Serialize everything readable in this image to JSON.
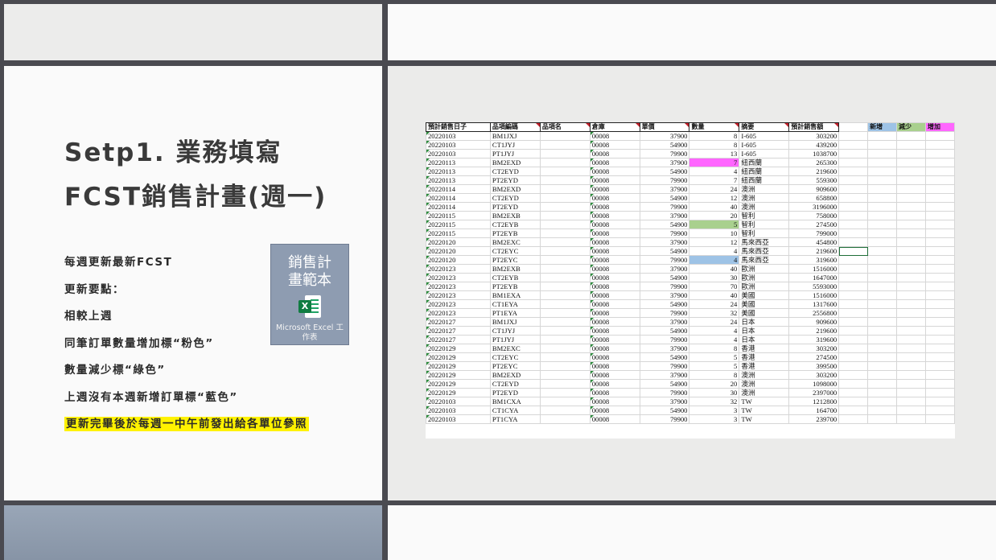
{
  "slide": {
    "title_line1": "Setp1. 業務填寫",
    "title_line2": "FCST銷售計畫(週一)",
    "notes": [
      "每週更新最新FCST",
      "更新要點：",
      "相較上週",
      "同筆訂單數量增加標“粉色”",
      "數量減少標“綠色”",
      "上週沒有本週新增訂單標“藍色”"
    ],
    "highlight_note": "更新完畢後於每週一中午前發出給各單位參照",
    "file_icon": {
      "name_line1": "銷售計",
      "name_line2": "畫範本",
      "caption_line1": "Microsoft Excel 工",
      "caption_line2": "作表",
      "icon": "excel-file-icon"
    }
  },
  "spreadsheet": {
    "headers": [
      "預計銷售日子",
      "品項編碼",
      "品項名",
      "倉庫",
      "單價",
      "數量",
      "摘要",
      "預計銷售額"
    ],
    "legend": [
      {
        "label": "新增",
        "color": "#9ec3e6"
      },
      {
        "label": "減少",
        "color": "#a9d08e"
      },
      {
        "label": "增加",
        "color": "#ff66ff"
      }
    ],
    "highlight_colors": {
      "pink": "#ff66ff",
      "green": "#a9d08e",
      "blue": "#9ec3e6"
    },
    "rows": [
      {
        "date": "20220103",
        "code": "BM1JXJ",
        "wh": "00008",
        "price": "37900",
        "qty": "8",
        "memo": "I-605",
        "amt": "303200"
      },
      {
        "date": "20220103",
        "code": "CT1JYJ",
        "wh": "00008",
        "price": "54900",
        "qty": "8",
        "memo": "I-605",
        "amt": "439200"
      },
      {
        "date": "20220103",
        "code": "PT1JYJ",
        "wh": "00008",
        "price": "79900",
        "qty": "13",
        "memo": "I-605",
        "amt": "1038700"
      },
      {
        "date": "20220113",
        "code": "BM2EXD",
        "wh": "00008",
        "price": "37900",
        "qty": "7",
        "memo": "紐西蘭",
        "amt": "265300",
        "hl": "pink"
      },
      {
        "date": "20220113",
        "code": "CT2EYD",
        "wh": "00008",
        "price": "54900",
        "qty": "4",
        "memo": "紐西蘭",
        "amt": "219600"
      },
      {
        "date": "20220113",
        "code": "PT2EYD",
        "wh": "00008",
        "price": "79900",
        "qty": "7",
        "memo": "紐西蘭",
        "amt": "559300"
      },
      {
        "date": "20220114",
        "code": "BM2EXD",
        "wh": "00008",
        "price": "37900",
        "qty": "24",
        "memo": "澳洲",
        "amt": "909600"
      },
      {
        "date": "20220114",
        "code": "CT2EYD",
        "wh": "00008",
        "price": "54900",
        "qty": "12",
        "memo": "澳洲",
        "amt": "658800"
      },
      {
        "date": "20220114",
        "code": "PT2EYD",
        "wh": "00008",
        "price": "79900",
        "qty": "40",
        "memo": "澳洲",
        "amt": "3196000"
      },
      {
        "date": "20220115",
        "code": "BM2EXB",
        "wh": "00008",
        "price": "37900",
        "qty": "20",
        "memo": "智利",
        "amt": "758000"
      },
      {
        "date": "20220115",
        "code": "CT2EYB",
        "wh": "00008",
        "price": "54900",
        "qty": "5",
        "memo": "智利",
        "amt": "274500",
        "hl": "green"
      },
      {
        "date": "20220115",
        "code": "PT2EYB",
        "wh": "00008",
        "price": "79900",
        "qty": "10",
        "memo": "智利",
        "amt": "799000"
      },
      {
        "date": "20220120",
        "code": "BM2EXC",
        "wh": "00008",
        "price": "37900",
        "qty": "12",
        "memo": "馬來西亞",
        "amt": "454800"
      },
      {
        "date": "20220120",
        "code": "CT2EYC",
        "wh": "00008",
        "price": "54900",
        "qty": "4",
        "memo": "馬來西亞",
        "amt": "219600"
      },
      {
        "date": "20220120",
        "code": "PT2EYC",
        "wh": "00008",
        "price": "79900",
        "qty": "4",
        "memo": "馬來西亞",
        "amt": "319600",
        "hl": "blue"
      },
      {
        "date": "20220123",
        "code": "BM2EXB",
        "wh": "00008",
        "price": "37900",
        "qty": "40",
        "memo": "歐洲",
        "amt": "1516000"
      },
      {
        "date": "20220123",
        "code": "CT2EYB",
        "wh": "00008",
        "price": "54900",
        "qty": "30",
        "memo": "歐洲",
        "amt": "1647000"
      },
      {
        "date": "20220123",
        "code": "PT2EYB",
        "wh": "00008",
        "price": "79900",
        "qty": "70",
        "memo": "歐洲",
        "amt": "5593000"
      },
      {
        "date": "20220123",
        "code": "BM1EXA",
        "wh": "00008",
        "price": "37900",
        "qty": "40",
        "memo": "美國",
        "amt": "1516000"
      },
      {
        "date": "20220123",
        "code": "CT1EYA",
        "wh": "00008",
        "price": "54900",
        "qty": "24",
        "memo": "美國",
        "amt": "1317600"
      },
      {
        "date": "20220123",
        "code": "PT1EYA",
        "wh": "00008",
        "price": "79900",
        "qty": "32",
        "memo": "美國",
        "amt": "2556800"
      },
      {
        "date": "20220127",
        "code": "BM1JXJ",
        "wh": "00008",
        "price": "37900",
        "qty": "24",
        "memo": "日本",
        "amt": "909600"
      },
      {
        "date": "20220127",
        "code": "CT1JYJ",
        "wh": "00008",
        "price": "54900",
        "qty": "4",
        "memo": "日本",
        "amt": "219600"
      },
      {
        "date": "20220127",
        "code": "PT1JYJ",
        "wh": "00008",
        "price": "79900",
        "qty": "4",
        "memo": "日本",
        "amt": "319600"
      },
      {
        "date": "20220129",
        "code": "BM2EXC",
        "wh": "00008",
        "price": "37900",
        "qty": "8",
        "memo": "香港",
        "amt": "303200"
      },
      {
        "date": "20220129",
        "code": "CT2EYC",
        "wh": "00008",
        "price": "54900",
        "qty": "5",
        "memo": "香港",
        "amt": "274500"
      },
      {
        "date": "20220129",
        "code": "PT2EYC",
        "wh": "00008",
        "price": "79900",
        "qty": "5",
        "memo": "香港",
        "amt": "399500"
      },
      {
        "date": "20220129",
        "code": "BM2EXD",
        "wh": "00008",
        "price": "37900",
        "qty": "8",
        "memo": "澳洲",
        "amt": "303200"
      },
      {
        "date": "20220129",
        "code": "CT2EYD",
        "wh": "00008",
        "price": "54900",
        "qty": "20",
        "memo": "澳洲",
        "amt": "1098000"
      },
      {
        "date": "20220129",
        "code": "PT2EYD",
        "wh": "00008",
        "price": "79900",
        "qty": "30",
        "memo": "澳洲",
        "amt": "2397000"
      },
      {
        "date": "20220103",
        "code": "BM1CXA",
        "wh": "00008",
        "price": "37900",
        "qty": "32",
        "memo": "TW",
        "amt": "1212800"
      },
      {
        "date": "20220103",
        "code": "CT1CYA",
        "wh": "00008",
        "price": "54900",
        "qty": "3",
        "memo": "TW",
        "amt": "164700"
      },
      {
        "date": "20220103",
        "code": "PT1CYA",
        "wh": "00008",
        "price": "79900",
        "qty": "3",
        "memo": "TW",
        "amt": "239700"
      }
    ]
  }
}
